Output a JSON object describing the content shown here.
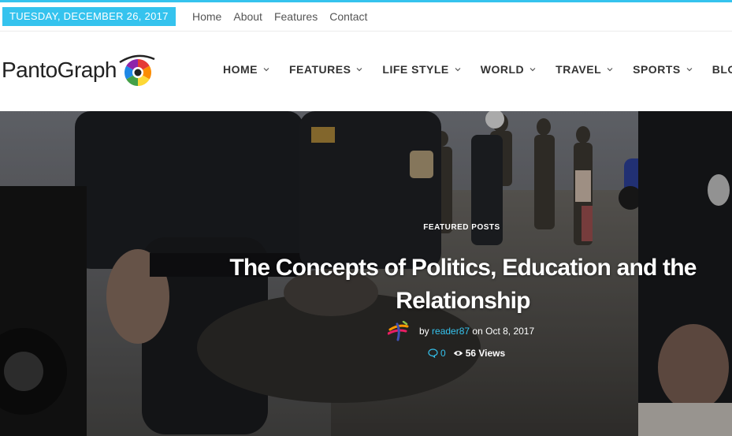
{
  "colors": {
    "accent": "#35c3ee",
    "text": "#333333",
    "white": "#ffffff"
  },
  "topbar": {
    "date": "TUESDAY, DECEMBER 26, 2017",
    "links": [
      "Home",
      "About",
      "Features",
      "Contact"
    ]
  },
  "logo": {
    "text": "PantoGraph",
    "icon": "aperture-logo-icon"
  },
  "nav": {
    "items": [
      "HOME",
      "FEATURES",
      "LIFE STYLE",
      "WORLD",
      "TRAVEL",
      "SPORTS",
      "BLOG"
    ],
    "dropdown_icon": "chevron-down-icon"
  },
  "hero": {
    "category": "FEATURED POSTS",
    "title": "The Concepts of Politics, Education and the Relationship",
    "by_label": "by",
    "author": "reader87",
    "date_text": "on Oct 8, 2017",
    "comments_count": "0",
    "views_text": "56 Views",
    "comment_icon": "comment-icon",
    "views_icon": "eye-icon"
  }
}
